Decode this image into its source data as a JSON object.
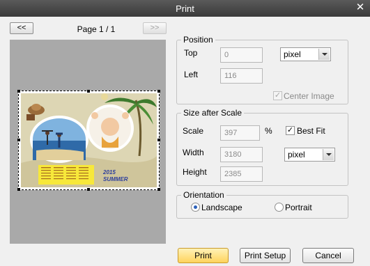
{
  "window": {
    "title": "Print",
    "close_glyph": "✕"
  },
  "nav": {
    "prev_label": "<<",
    "next_label": ">>",
    "page_label": "Page 1 / 1"
  },
  "preview": {
    "year_text": "2015",
    "season_text": "SUMMER"
  },
  "position": {
    "legend": "Position",
    "top_label": "Top",
    "top_value": "0",
    "left_label": "Left",
    "left_value": "116",
    "unit_value": "pixel",
    "center_label": "Center Image",
    "center_checked": true
  },
  "scale": {
    "legend": "Size after Scale",
    "scale_label": "Scale",
    "scale_value": "397",
    "percent_sign": "%",
    "bestfit_label": "Best Fit",
    "bestfit_checked": true,
    "width_label": "Width",
    "width_value": "3180",
    "height_label": "Height",
    "height_value": "2385",
    "unit_value": "pixel"
  },
  "orientation": {
    "legend": "Orientation",
    "landscape_label": "Landscape",
    "portrait_label": "Portrait",
    "selected": "Landscape"
  },
  "buttons": {
    "print": "Print",
    "setup": "Print Setup",
    "cancel": "Cancel"
  }
}
